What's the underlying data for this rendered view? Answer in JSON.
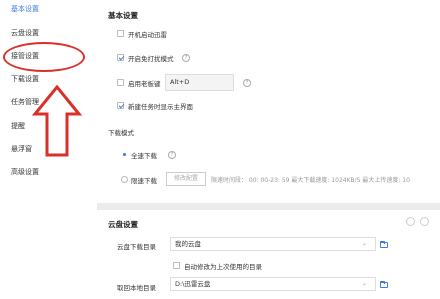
{
  "sidebar": {
    "items": [
      {
        "label": "基本设置",
        "active": true
      },
      {
        "label": "云盘设置"
      },
      {
        "label": "接管设置"
      },
      {
        "label": "下载设置"
      },
      {
        "label": "任务管理"
      },
      {
        "label": "提醒"
      },
      {
        "label": "悬浮窗"
      },
      {
        "label": "高级设置"
      }
    ]
  },
  "basic": {
    "title": "基本设置",
    "autostart_label": "开机启动迅雷",
    "free_mode_label": "开启免打扰模式",
    "boss_key_label": "启用老板键",
    "boss_key_value": "Alt+D",
    "show_main_label": "新建任务时显示主界面",
    "download_mode_title": "下载模式",
    "full_speed_label": "全速下载",
    "limit_speed_label": "限速下载",
    "modify_config_label": "修改配置",
    "limit_info": "限速时间段： 00: 00-23: 59  最大下载速度: 1024KB/S  最大上传速度: 10"
  },
  "cloud": {
    "title": "云盘设置",
    "download_dir_label": "云盘下载目录",
    "download_dir_value": "我的云盘",
    "auto_modify_label": "自动修改为上次使用的目录",
    "local_dir_label": "取回本地目录",
    "local_dir_value": "D:\\迅雷云盘"
  },
  "colors": {
    "accent": "#3b7be8",
    "annotation": "#d9302a"
  }
}
